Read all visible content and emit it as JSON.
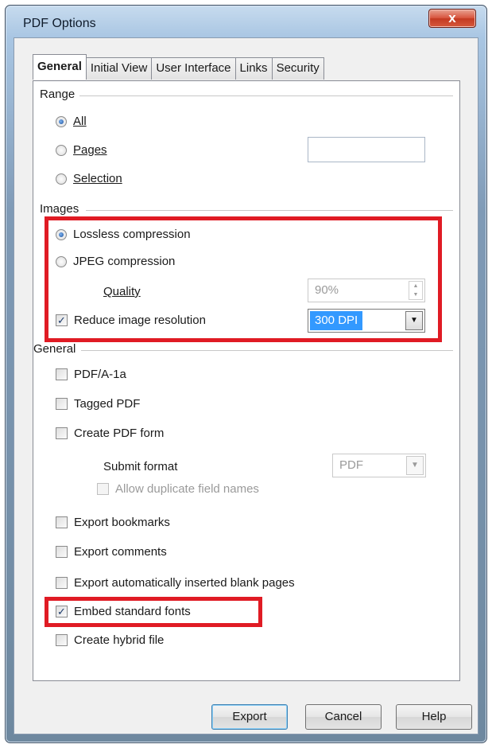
{
  "window": {
    "title": "PDF Options",
    "close_glyph": "x"
  },
  "tabs": [
    {
      "label": "General",
      "active": true
    },
    {
      "label": "Initial View",
      "active": false
    },
    {
      "label": "User Interface",
      "active": false
    },
    {
      "label": "Links",
      "active": false
    },
    {
      "label": "Security",
      "active": false
    }
  ],
  "range": {
    "label": "Range",
    "all": "All",
    "pages": "Pages",
    "pages_value": "",
    "selection": "Selection",
    "selected": "all"
  },
  "images": {
    "label": "Images",
    "lossless": "Lossless compression",
    "jpeg": "JPEG compression",
    "selected": "lossless",
    "quality_label": "Quality",
    "quality_value": "90%",
    "reduce_label": "Reduce image resolution",
    "reduce_checked": true,
    "resolution_value": "300 DPI"
  },
  "general": {
    "label": "General",
    "pdfa": {
      "label": "PDF/A-1a",
      "checked": false
    },
    "tagged": {
      "label": "Tagged PDF",
      "checked": false
    },
    "create_form": {
      "label": "Create PDF form",
      "checked": false
    },
    "submit_format_label": "Submit format",
    "submit_format_value": "PDF",
    "allow_duplicate": {
      "label": "Allow duplicate field names",
      "checked": false
    },
    "bookmarks": {
      "label": "Export bookmarks",
      "checked": false
    },
    "comments": {
      "label": "Export comments",
      "checked": false
    },
    "blank_pages": {
      "label": "Export automatically inserted blank pages",
      "checked": false
    },
    "embed_fonts": {
      "label": "Embed standard fonts",
      "checked": true
    },
    "hybrid": {
      "label": "Create hybrid file",
      "checked": false
    }
  },
  "buttons": {
    "export": "Export",
    "cancel": "Cancel",
    "help": "Help"
  },
  "check_glyph": "✓",
  "highlight_color": "#e01b24"
}
